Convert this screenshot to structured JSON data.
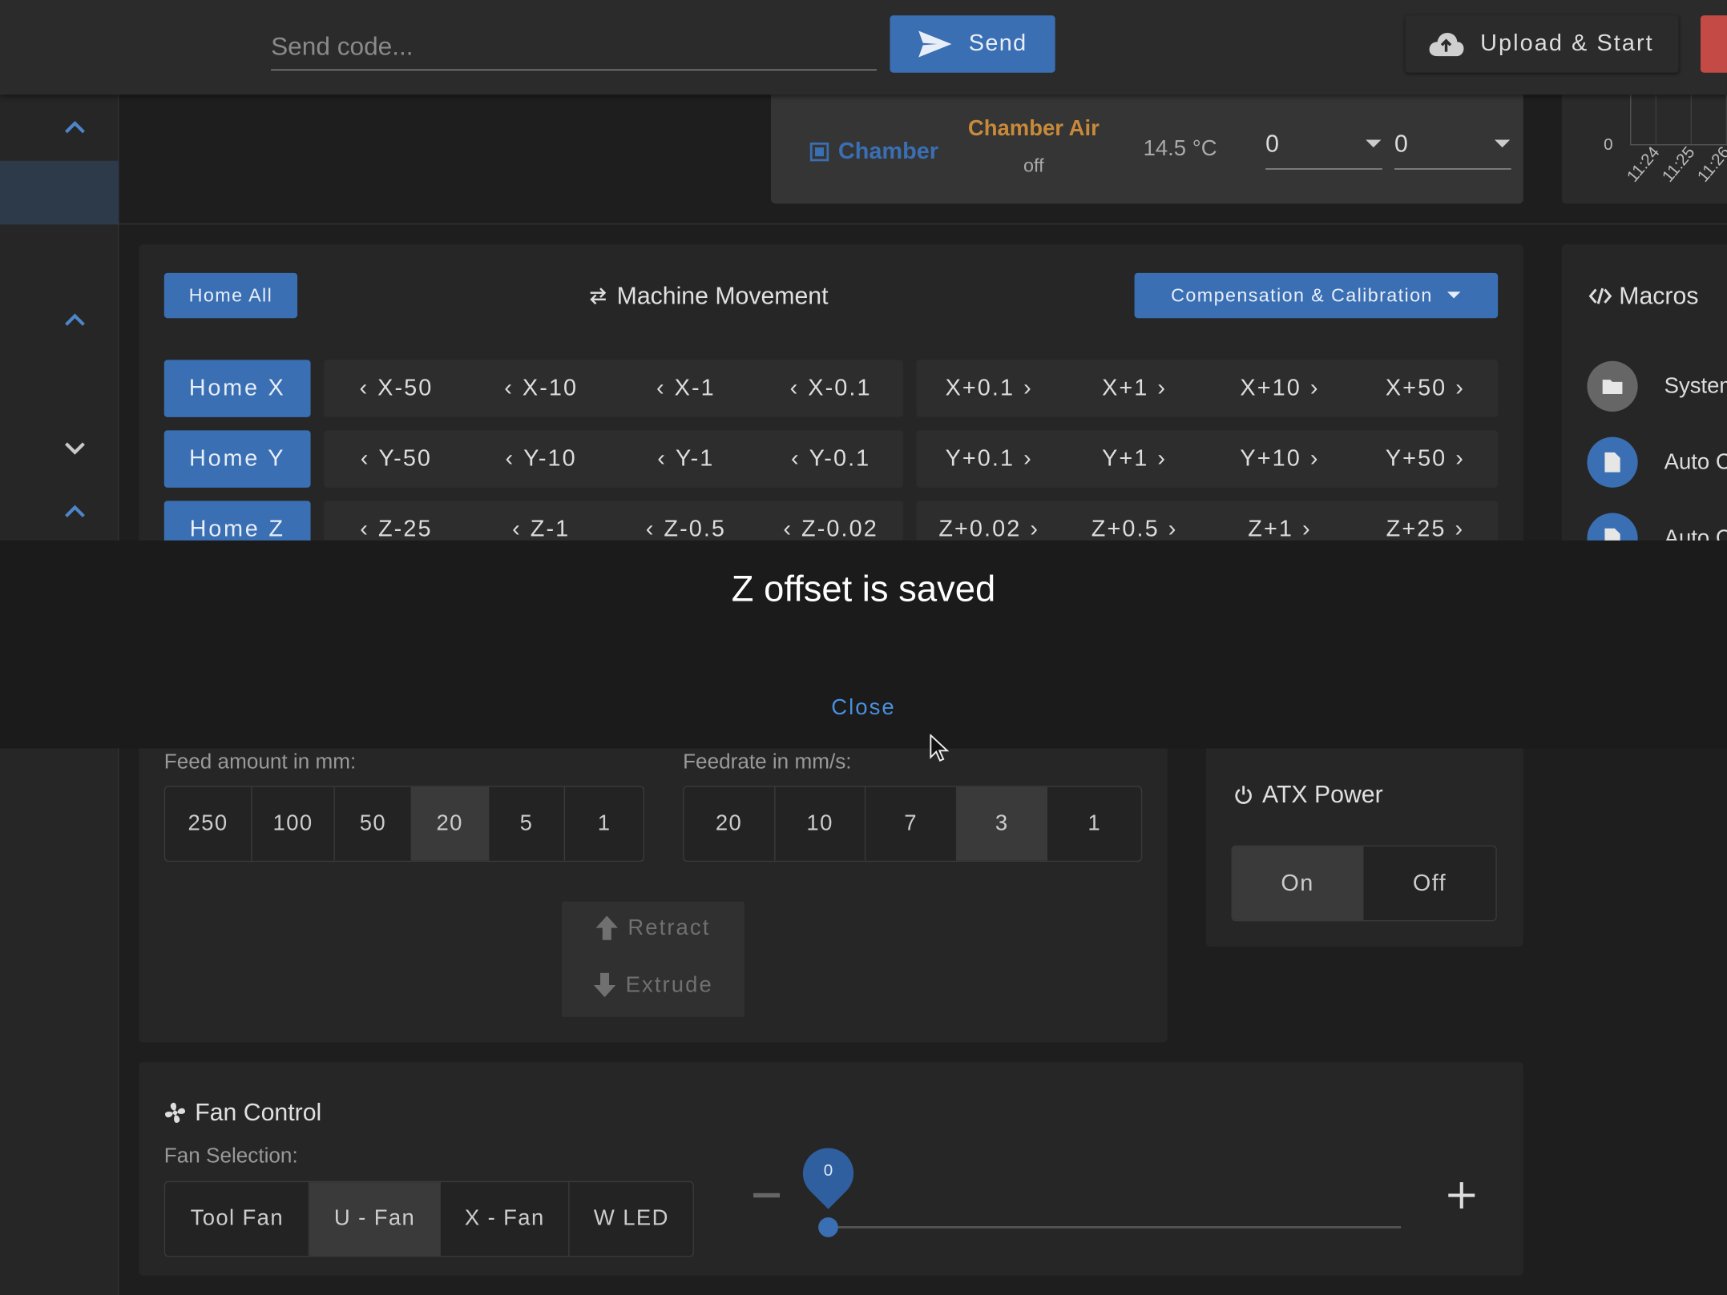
{
  "toolbar": {
    "code_placeholder": "Send code...",
    "send_label": "Send",
    "upload_label": "Upload & Start"
  },
  "chamber": {
    "label": "Chamber",
    "heater_name": "Chamber Air",
    "heater_state": "off",
    "current_temp": "14.5 °C",
    "active_value": "0",
    "standby_value": "0"
  },
  "temp_chart": {
    "y_tick": "0",
    "x_ticks": [
      "11:24",
      "11:25",
      "11:26"
    ]
  },
  "movement": {
    "home_all": "Home All",
    "title": "Machine Movement",
    "compensation": "Compensation & Calibration",
    "rows": [
      {
        "home": "Home X",
        "minus": [
          "X-50",
          "X-10",
          "X-1",
          "X-0.1"
        ],
        "plus": [
          "X+0.1",
          "X+1",
          "X+10",
          "X+50"
        ]
      },
      {
        "home": "Home Y",
        "minus": [
          "Y-50",
          "Y-10",
          "Y-1",
          "Y-0.1"
        ],
        "plus": [
          "Y+0.1",
          "Y+1",
          "Y+10",
          "Y+50"
        ]
      },
      {
        "home": "Home Z",
        "minus": [
          "Z-25",
          "Z-1",
          "Z-0.5",
          "Z-0.02"
        ],
        "plus": [
          "Z+0.02",
          "Z+0.5",
          "Z+1",
          "Z+25"
        ]
      }
    ]
  },
  "macros": {
    "title": "Macros",
    "items": [
      "System",
      "Auto C",
      "Auto C"
    ]
  },
  "dialog": {
    "message": "Z offset is saved",
    "close_label": "Close"
  },
  "extrusion": {
    "feed_label": "Feed amount in mm:",
    "feed_options": [
      "250",
      "100",
      "50",
      "20",
      "5",
      "1"
    ],
    "feed_selected": "20",
    "rate_label": "Feedrate in mm/s:",
    "rate_options": [
      "20",
      "10",
      "7",
      "3",
      "1"
    ],
    "rate_selected": "3",
    "retract_label": "Retract",
    "extrude_label": "Extrude"
  },
  "atx": {
    "title": "ATX Power",
    "on_label": "On",
    "off_label": "Off"
  },
  "fan": {
    "title": "Fan Control",
    "selection_label": "Fan Selection:",
    "fans": [
      "Tool Fan",
      "U - Fan",
      "X - Fan",
      "W LED"
    ],
    "selected": "U - Fan",
    "value": "0",
    "value_fraction": 0
  },
  "colors": {
    "accent": "#3a6fb3",
    "link": "#4a8fe0",
    "heater_orange": "#c88a3a",
    "danger": "#c44a45"
  }
}
